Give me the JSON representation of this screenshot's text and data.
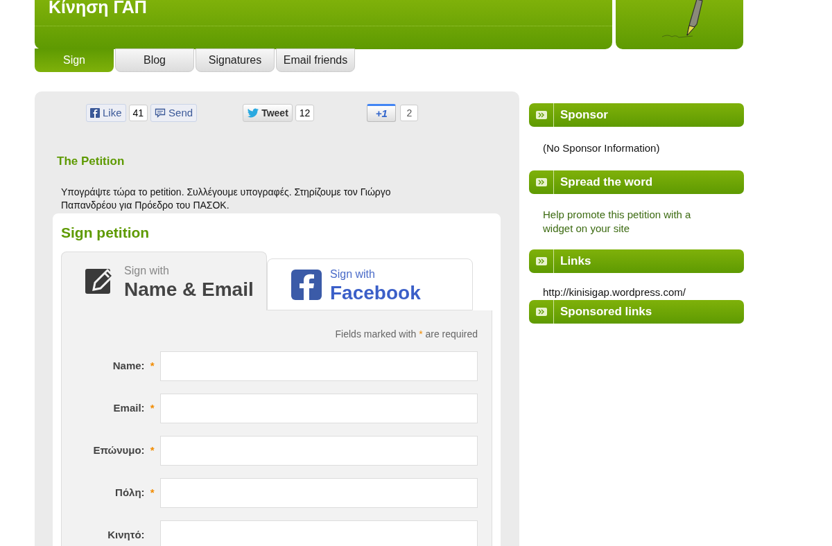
{
  "header": {
    "title": "Κίνηση ΓΑΠ"
  },
  "tabs": [
    {
      "label": "Sign",
      "selected": true
    },
    {
      "label": "Blog",
      "selected": false
    },
    {
      "label": "Signatures",
      "selected": false
    },
    {
      "label": "Email friends",
      "selected": false
    }
  ],
  "social": {
    "like": "Like",
    "like_count": "41",
    "send": "Send",
    "tweet": "Tweet",
    "tweet_count": "12",
    "plusone": "+1",
    "plusone_count": "2"
  },
  "petition": {
    "heading": "The Petition",
    "text": "Υπογράψτε τώρα το petition. Συλλέγουμε υπογραφές. Στηρίζουμε τον Γιώργο Παπανδρέου για Πρόεδρο του ΠΑΣΟΚ."
  },
  "sign": {
    "heading": "Sign petition",
    "methods": [
      {
        "kind": "email",
        "small": "Sign with",
        "big": "Name & Email",
        "selected": true
      },
      {
        "kind": "facebook",
        "small": "Sign with",
        "big": "Facebook",
        "selected": false
      }
    ],
    "note_before": "Fields marked with",
    "required_mark": "*",
    "note_after": "are required",
    "fields": [
      {
        "label": "Name:",
        "required": true
      },
      {
        "label": "Email:",
        "required": true
      },
      {
        "label": "Επώνυμο:",
        "required": true
      },
      {
        "label": "Πόλη:",
        "required": true
      },
      {
        "label": "Κινητό:",
        "required": false
      }
    ]
  },
  "sidebar": [
    {
      "title": "Sponsor",
      "kind": "plain",
      "text": "(No Sponsor Information)"
    },
    {
      "title": "Spread the word",
      "kind": "link",
      "text": "Help promote this petition with a widget on your site"
    },
    {
      "title": "Links",
      "kind": "plain",
      "text": "http://kinisigap.wordpress.com/"
    },
    {
      "title": "Sponsored links",
      "kind": "none"
    }
  ]
}
